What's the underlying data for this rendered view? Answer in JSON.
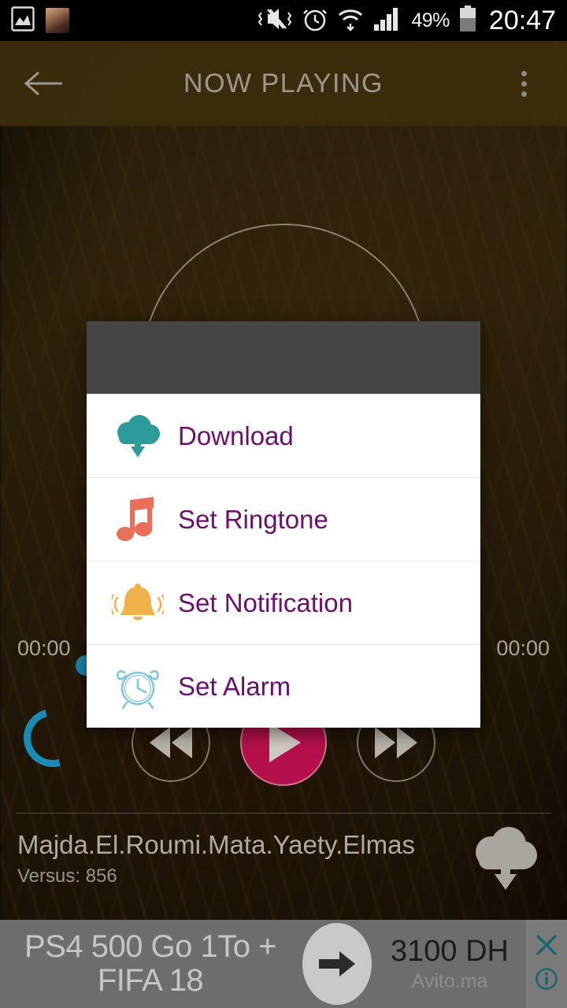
{
  "statusbar": {
    "icons": [
      "image-icon",
      "photo-thumbnail-icon",
      "vibrate-mute-icon",
      "alarm-clock-icon",
      "wifi-icon",
      "signal-bars-icon"
    ],
    "battery_percent": "49%",
    "clock": "20:47"
  },
  "appbar": {
    "back_label": "back-arrow",
    "title": "NOW PLAYING",
    "overflow_label": "more-options"
  },
  "player": {
    "time_elapsed": "00:00",
    "time_total": "00:00",
    "previous_label": "previous-track",
    "play_label": "play",
    "next_label": "next-track",
    "track_title": "Majda.El.Roumi.Mata.Yaety.Elmas",
    "track_subtitle": "Versus: 856",
    "download_label": "download-track"
  },
  "dialog": {
    "header_text": "",
    "items": [
      {
        "label": "Download",
        "icon": "cloud-download-icon",
        "color": "#2d9a9c"
      },
      {
        "label": "Set Ringtone",
        "icon": "music-note-icon",
        "color": "#e8705a"
      },
      {
        "label": "Set Notification",
        "icon": "bell-icon",
        "color": "#efb14a"
      },
      {
        "label": "Set Alarm",
        "icon": "alarm-clock-icon",
        "color": "#7fc6e0"
      }
    ]
  },
  "ad": {
    "headline_line1": "PS4 500 Go 1To +",
    "headline_line2": "FIFA 18",
    "cta_label": "arrow-right",
    "price": "3100 DH",
    "source": "Avito.ma",
    "close_label": "close-ad",
    "info_label": "ad-info"
  },
  "colors": {
    "accent_purple": "#6b0f6e",
    "play_button": "#b5104b",
    "dialog_header": "#454545",
    "ad_background": "#6d6d6b",
    "spinner": "#1a8bb3"
  }
}
